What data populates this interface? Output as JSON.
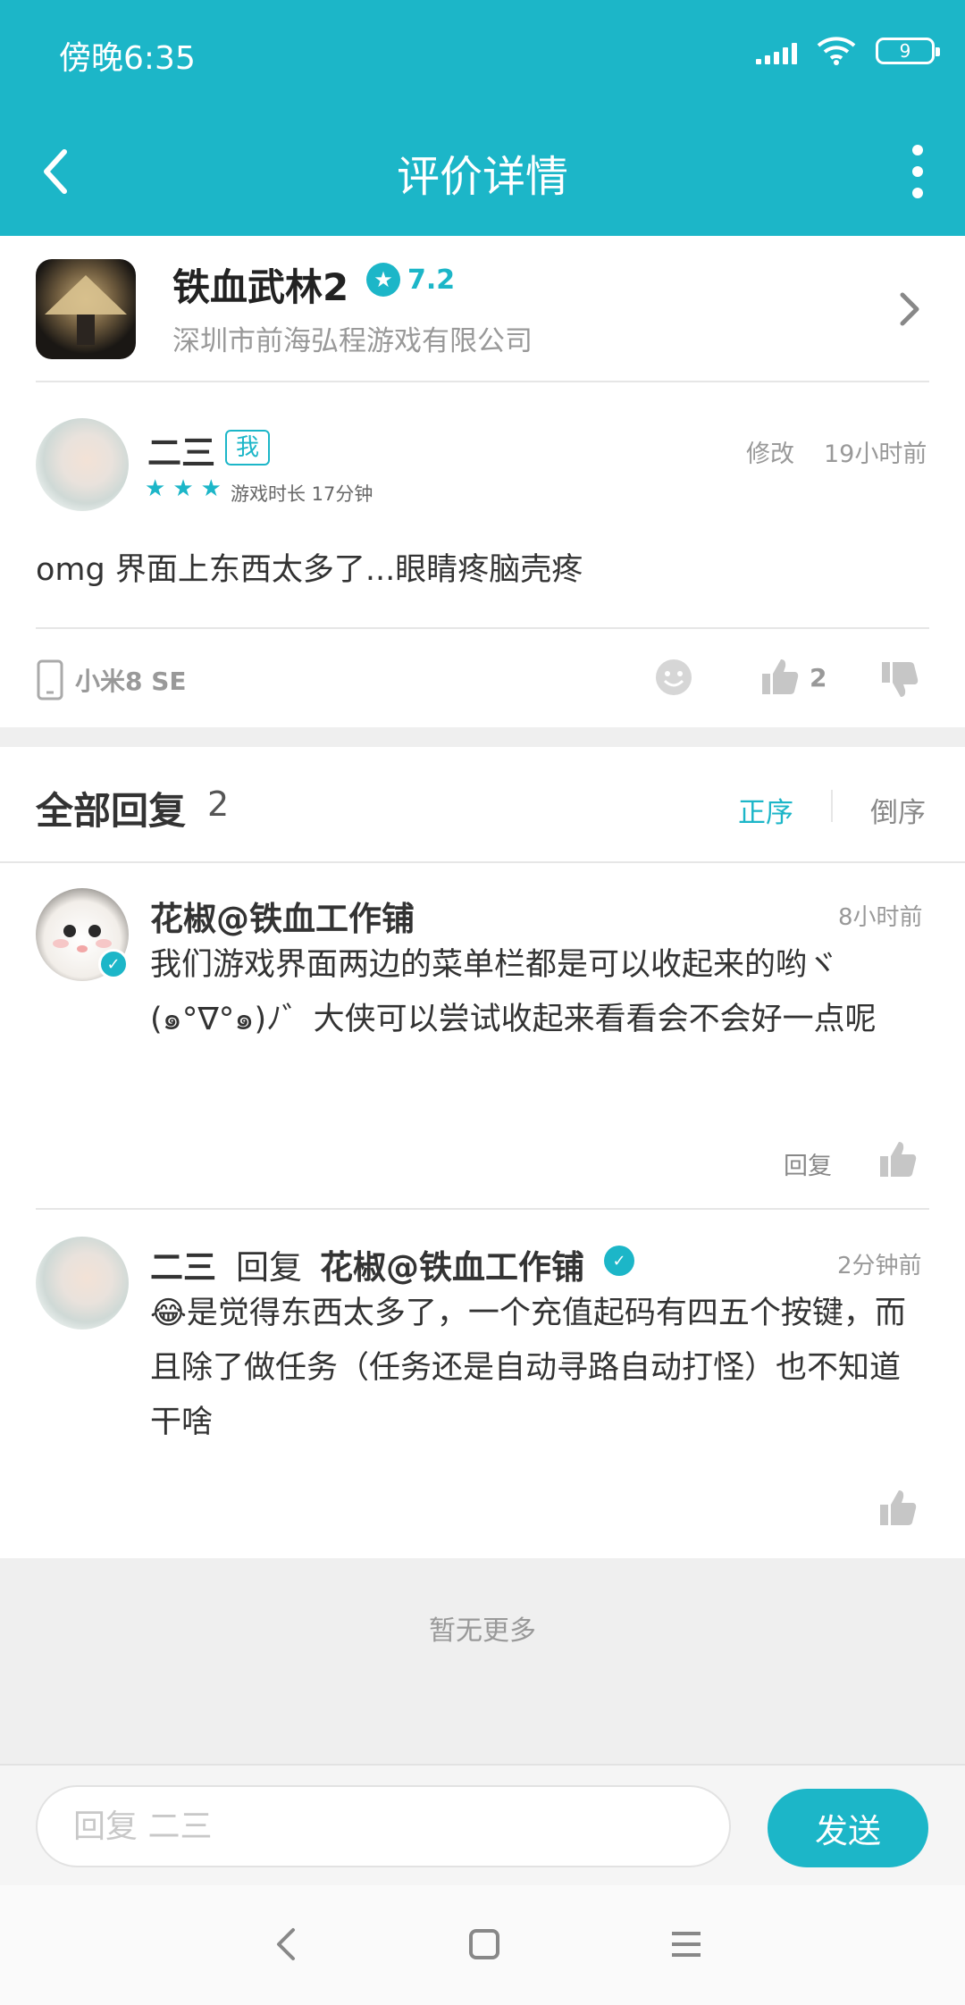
{
  "status_bar": {
    "time": "傍晚6:35",
    "battery": "9"
  },
  "app_bar": {
    "title": "评价详情",
    "back_icon": "back-arrow-icon",
    "menu_icon": "more-vertical-icon"
  },
  "game": {
    "name": "铁血武林2",
    "rating": "7.2",
    "company": "深圳市前海弘程游戏有限公司"
  },
  "review": {
    "user": "二三",
    "me_tag": "我",
    "stars": 3,
    "playtime": "游戏时长 17分钟",
    "edit_label": "修改",
    "time": "19小时前",
    "content": "omg 界面上东西太多了...眼睛疼脑壳疼",
    "device": "小米8 SE",
    "like_count": "2"
  },
  "replies_header": {
    "title": "全部回复",
    "count": "2",
    "sort_asc": "正序",
    "sort_desc": "倒序"
  },
  "replies": [
    {
      "user": "花椒@铁血工作铺",
      "time": "8小时前",
      "text": "我们游戏界面两边的菜单栏都是可以收起来的哟ヾ(๑°∇°๑)ﾉ゛大侠可以尝试收起来看看会不会好一点呢",
      "reply_label": "回复"
    },
    {
      "user": "二三",
      "reply_word": "回复",
      "target": "花椒@铁血工作铺",
      "time": "2分钟前",
      "text": "😂是觉得东西太多了，一个充值起码有四五个按键，而且除了做任务（任务还是自动寻路自动打怪）也不知道干啥"
    }
  ],
  "footer": {
    "no_more": "暂无更多"
  },
  "input": {
    "placeholder": "回复 二三",
    "value": "",
    "send_label": "发送"
  },
  "colors": {
    "accent": "#1cb6c8",
    "background_band": "#efefef"
  }
}
